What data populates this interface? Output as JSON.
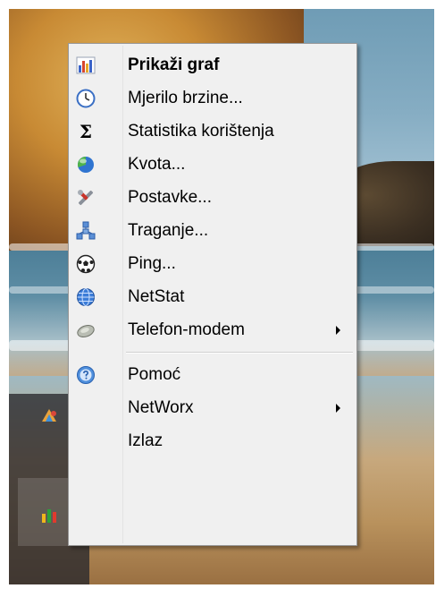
{
  "menu": {
    "items": [
      {
        "label": "Prikaži graf",
        "icon": "bar-chart-icon",
        "bold": true
      },
      {
        "label": "Mjerilo brzine...",
        "icon": "clock-icon"
      },
      {
        "label": "Statistika korištenja",
        "icon": "sigma-icon"
      },
      {
        "label": "Kvota...",
        "icon": "quota-pie-icon"
      },
      {
        "label": "Postavke...",
        "icon": "tools-icon"
      },
      {
        "label": "Traganje...",
        "icon": "network-trace-icon"
      },
      {
        "label": "Ping...",
        "icon": "ball-icon"
      },
      {
        "label": "NetStat",
        "icon": "globe-icon"
      },
      {
        "label": "Telefon-modem",
        "icon": "modem-icon",
        "submenu": true
      },
      {
        "label": "Pomoć",
        "icon": "help-icon"
      },
      {
        "label": "NetWorx",
        "icon": "",
        "submenu": true
      },
      {
        "label": "Izlaz",
        "icon": ""
      }
    ]
  },
  "sigma_glyph": "Σ"
}
